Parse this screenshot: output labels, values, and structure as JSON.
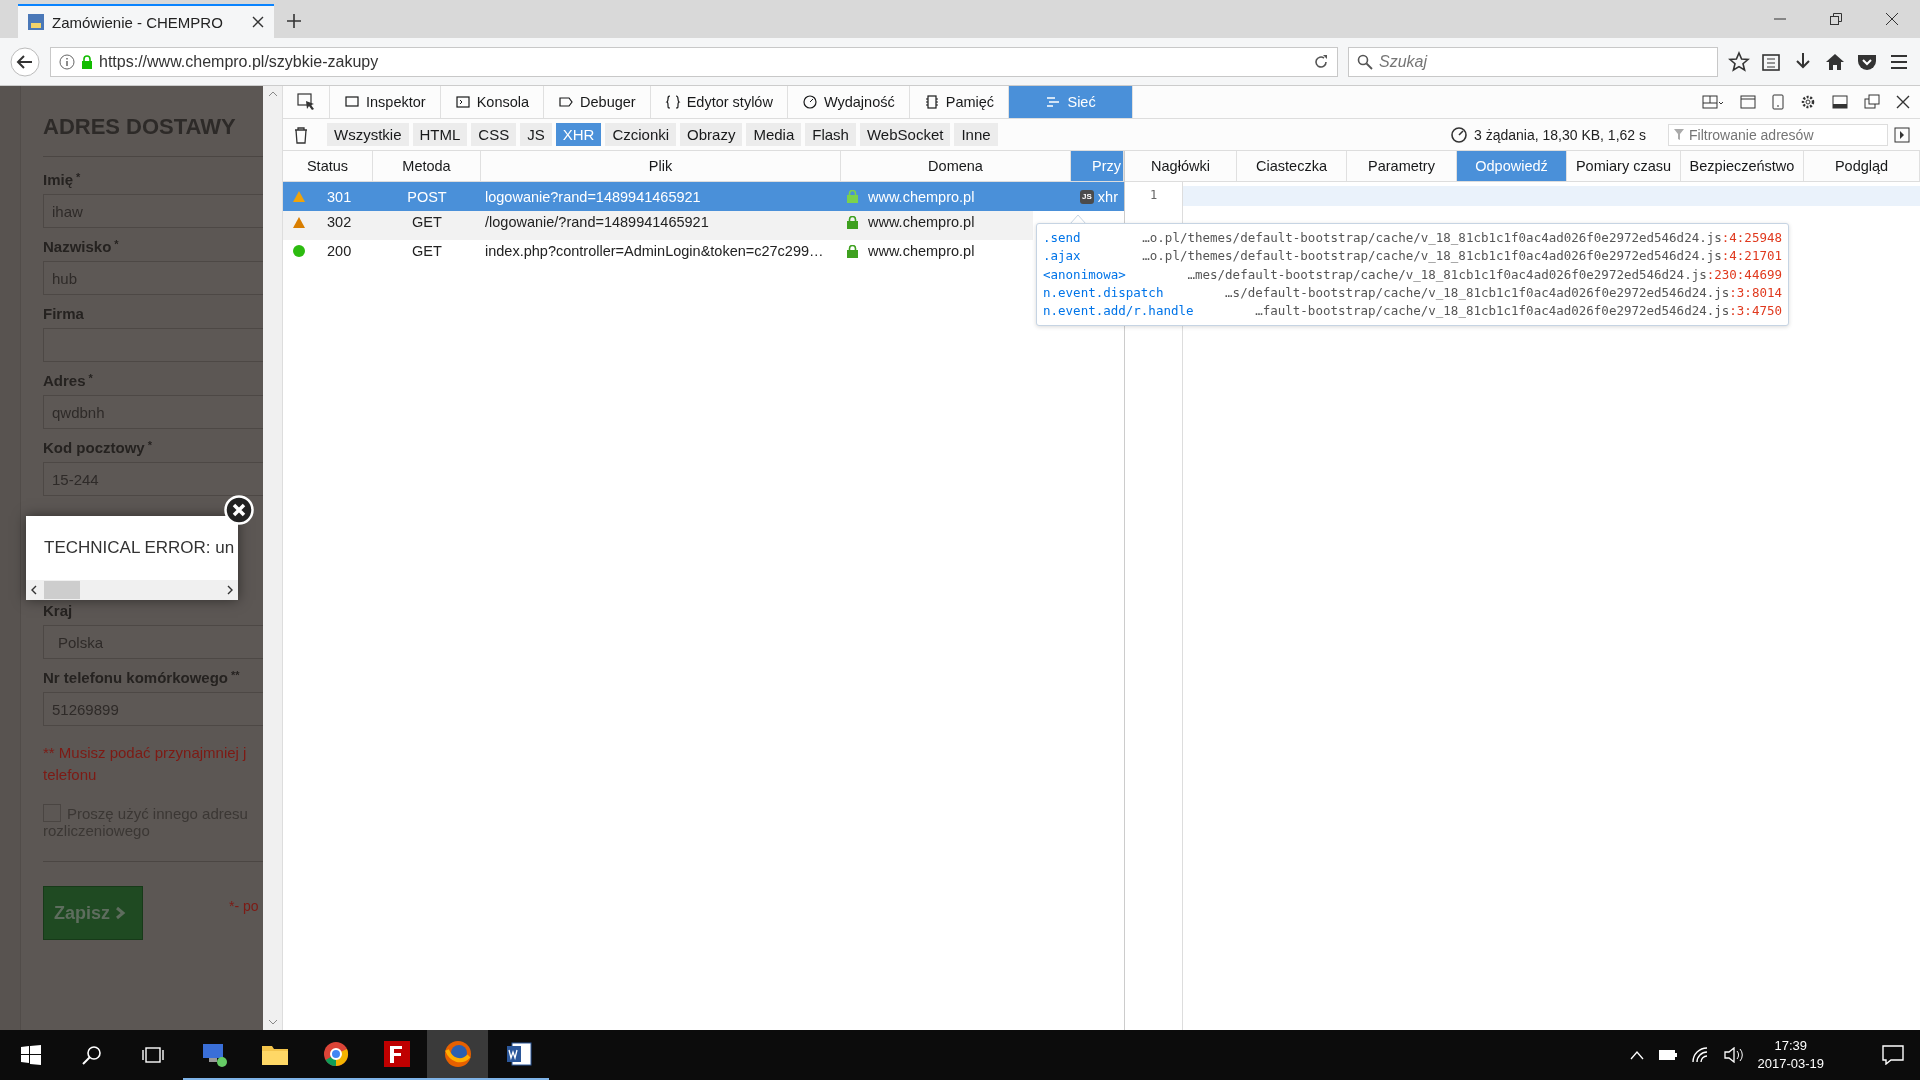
{
  "browser": {
    "tab_title": "Zamówienie - CHEMPRO",
    "url": "https://www.chempro.pl/szybkie-zakupy",
    "search": {
      "placeholder": "Szukaj"
    }
  },
  "page": {
    "heading": "ADRES DOSTAWY",
    "fields": [
      {
        "label": "Imię",
        "mark": "*",
        "value": "ihaw"
      },
      {
        "label": "Nazwisko",
        "mark": "*",
        "value": "hub"
      },
      {
        "label": "Firma"
      },
      {
        "label": "Adres",
        "mark": "*",
        "value": "qwdbnh"
      },
      {
        "label": "Kod pocztowy",
        "mark": "*",
        "value": "15-244"
      }
    ],
    "country": {
      "label": "Kraj",
      "value": "Polska"
    },
    "phone": {
      "label": "Nr telefonu komórkowego",
      "mark": "**",
      "value": "51269899"
    },
    "error_lines": [
      "** Musisz podać przynajmniej j",
      "telefonu"
    ],
    "checkbox": {
      "checked": false,
      "lines": [
        "Proszę użyć innego adresu",
        "rozliczeniowego"
      ]
    },
    "save_button": "Zapisz",
    "required_note": "*- po"
  },
  "popup": {
    "message": "TECHNICAL ERROR: un"
  },
  "devtools": {
    "tools": [
      {
        "label": "Inspektor",
        "selected": false
      },
      {
        "label": "Konsola",
        "selected": false
      },
      {
        "label": "Debuger",
        "selected": false
      },
      {
        "label": "Edytor stylów",
        "selected": false
      },
      {
        "label": "Wydajność",
        "selected": false
      },
      {
        "label": "Pamięć",
        "selected": false
      },
      {
        "label": "Sieć",
        "selected": true
      }
    ],
    "filters": [
      {
        "label": "Wszystkie",
        "selected": false
      },
      {
        "label": "HTML",
        "selected": false
      },
      {
        "label": "CSS",
        "selected": false
      },
      {
        "label": "JS",
        "selected": false
      },
      {
        "label": "XHR",
        "selected": true
      },
      {
        "label": "Czcionki",
        "selected": false
      },
      {
        "label": "Obrazy",
        "selected": false
      },
      {
        "label": "Media",
        "selected": false
      },
      {
        "label": "Flash",
        "selected": false
      },
      {
        "label": "WebSocket",
        "selected": false
      },
      {
        "label": "Inne",
        "selected": false
      }
    ],
    "summary": "3 żądania, 18,30 KB, 1,62 s",
    "url_filter": {
      "placeholder": "Filtrowanie adresów"
    },
    "columns": [
      {
        "label": "Status",
        "selected": false
      },
      {
        "label": "Metoda",
        "selected": false
      },
      {
        "label": "Plik",
        "selected": false
      },
      {
        "label": "Domena",
        "selected": false
      },
      {
        "label": "Przy",
        "selected": true
      }
    ],
    "requests": [
      {
        "kind": "warning",
        "color": "#f0a30a",
        "status": "301",
        "method": "POST",
        "file": "logowanie?rand=1489941465921",
        "domain": "www.chempro.pl",
        "cause_badge": "JS",
        "cause": "xhr",
        "selected": true
      },
      {
        "kind": "warning",
        "color": "#d97e00",
        "status": "302",
        "method": "GET",
        "file": "/logowanie/?rand=1489941465921",
        "domain": "www.chempro.pl",
        "selected": false
      },
      {
        "kind": "success",
        "color": "#2cbb0f",
        "status": "200",
        "method": "GET",
        "file": "index.php?controller=AdminLogin&token=c27c299…",
        "domain": "www.chempro.pl",
        "selected": false
      }
    ],
    "detail_tabs": [
      {
        "label": "Nagłówki",
        "selected": false
      },
      {
        "label": "Ciasteczka",
        "selected": false
      },
      {
        "label": "Parametry",
        "selected": false
      },
      {
        "label": "Odpowiedź",
        "selected": true
      },
      {
        "label": "Pomiary czasu",
        "selected": false
      },
      {
        "label": "Bezpieczeństwo",
        "selected": false
      },
      {
        "label": "Podgląd",
        "selected": false
      }
    ],
    "line_number": "1",
    "stack": [
      {
        "function": ".send",
        "file": "…o.pl/themes/default-bootstrap/cache/v_18_81cb1c1f0ac4ad026f0e2972ed546d24.js",
        "location": ":4:25948"
      },
      {
        "function": ".ajax",
        "file": "…o.pl/themes/default-bootstrap/cache/v_18_81cb1c1f0ac4ad026f0e2972ed546d24.js",
        "location": ":4:21701"
      },
      {
        "function": "<anonimowa>",
        "file": "…mes/default-bootstrap/cache/v_18_81cb1c1f0ac4ad026f0e2972ed546d24.js",
        "location": ":230:44699"
      },
      {
        "function": "n.event.dispatch",
        "file": "…s/default-bootstrap/cache/v_18_81cb1c1f0ac4ad026f0e2972ed546d24.js",
        "location": ":3:8014"
      },
      {
        "function": "n.event.add/r.handle",
        "file": "…fault-bootstrap/cache/v_18_81cb1c1f0ac4ad026f0e2972ed546d24.js",
        "location": ":3:4750"
      }
    ]
  },
  "taskbar": {
    "apps": [
      {
        "kind": "network",
        "selected": false
      },
      {
        "kind": "folder",
        "selected": false
      },
      {
        "kind": "chrome",
        "selected": false
      },
      {
        "kind": "filezilla",
        "selected": false
      },
      {
        "kind": "firefox",
        "selected": true
      },
      {
        "kind": "word",
        "selected": false
      }
    ],
    "time": "17:39",
    "date": "2017-03-19"
  }
}
